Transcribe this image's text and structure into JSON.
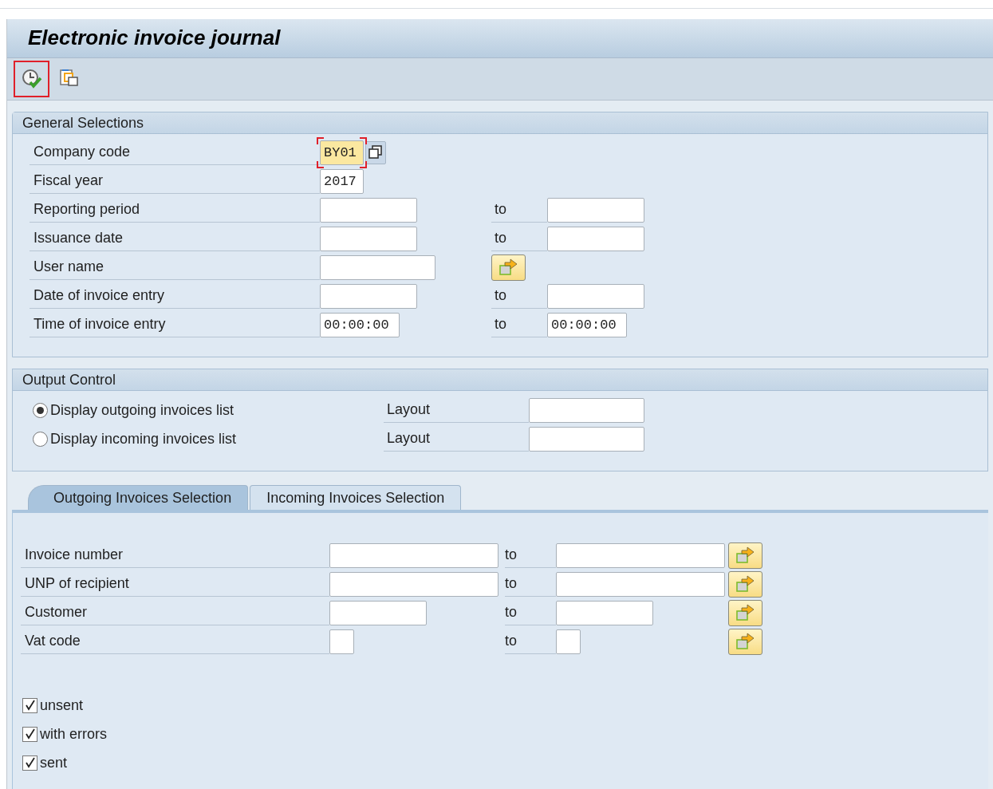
{
  "window": {
    "title": "Electronic invoice journal"
  },
  "toolbar": [
    {
      "kind": "execute",
      "highlighted": true
    },
    {
      "kind": "variants",
      "highlighted": false
    }
  ],
  "general_selections": {
    "title": "General Selections",
    "rows": [
      {
        "label": "Company code",
        "kind": "single",
        "value": "BY01",
        "focused": true
      },
      {
        "label": "Fiscal year",
        "kind": "single",
        "value": "2017",
        "focused": false
      },
      {
        "label": "Reporting period",
        "kind": "range",
        "to": "to",
        "focused": false
      },
      {
        "label": "Issuance date",
        "kind": "range",
        "to": "to",
        "focused": false
      },
      {
        "label": "User name",
        "kind": "multi",
        "focused": false
      },
      {
        "label": "Date of invoice entry",
        "kind": "range",
        "to": "to",
        "focused": false
      },
      {
        "label": "Time of invoice entry",
        "kind": "range",
        "value": "00:00:00",
        "to": "to",
        "value_to": "00:00:00",
        "focused": false
      }
    ]
  },
  "output_control": {
    "title": "Output Control",
    "options": [
      {
        "label": "Display outgoing invoices list",
        "selected": true,
        "layout_label": "Layout"
      },
      {
        "label": "Display incoming invoices list",
        "selected": false,
        "layout_label": "Layout"
      }
    ]
  },
  "tabs": [
    {
      "label": "Outgoing Invoices Selection",
      "selected": true
    },
    {
      "label": "Incoming Invoices Selection",
      "selected": false
    }
  ],
  "selection_rows": [
    {
      "label": "Invoice number",
      "to": "to"
    },
    {
      "label": "UNP of recipient",
      "to": "to"
    },
    {
      "label": "Customer",
      "to": "to"
    },
    {
      "label": "Vat code",
      "to": "to"
    }
  ],
  "status_filters": [
    {
      "label": "unsent",
      "checked": true
    },
    {
      "label": "with errors",
      "checked": true
    },
    {
      "label": "sent",
      "checked": true
    }
  ]
}
